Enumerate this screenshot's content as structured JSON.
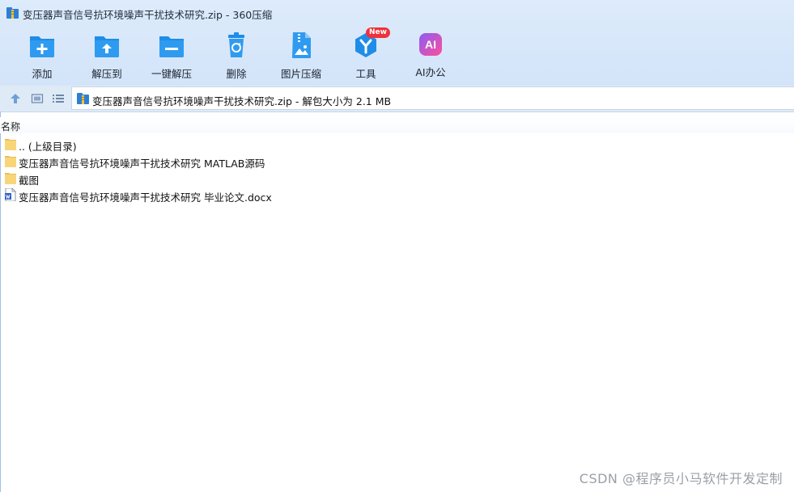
{
  "window": {
    "title": "变压器声音信号抗环境噪声干扰技术研究.zip - 360压缩"
  },
  "toolbar": {
    "buttons": [
      {
        "label": "添加",
        "icon": "add-icon"
      },
      {
        "label": "解压到",
        "icon": "extract-to-icon"
      },
      {
        "label": "一键解压",
        "icon": "one-click-extract-icon"
      },
      {
        "label": "删除",
        "icon": "delete-icon"
      },
      {
        "label": "图片压缩",
        "icon": "image-compress-icon"
      },
      {
        "label": "工具",
        "icon": "tools-icon",
        "badge": "New"
      },
      {
        "label": "AI办公",
        "icon": "ai-office-icon",
        "icon_text": "AI"
      }
    ]
  },
  "address": {
    "path": "变压器声音信号抗环境噪声干扰技术研究.zip - 解包大小为 2.1 MB"
  },
  "list": {
    "column_name": "名称",
    "items": [
      {
        "name": ".. (上级目录)",
        "type": "folder"
      },
      {
        "name": "变压器声音信号抗环境噪声干扰技术研究 MATLAB源码",
        "type": "folder"
      },
      {
        "name": "截图",
        "type": "folder"
      },
      {
        "name": "变压器声音信号抗环境噪声干扰技术研究 毕业论文.docx",
        "type": "docx"
      }
    ]
  },
  "watermark": "CSDN @程序员小马软件开发定制",
  "colors": {
    "accent_blue": "#1e8de8",
    "folder_yellow": "#f9d57a",
    "badge_red": "#f0313c",
    "ai_gradient_start": "#8a5cf6",
    "ai_gradient_end": "#ff4f9a"
  }
}
